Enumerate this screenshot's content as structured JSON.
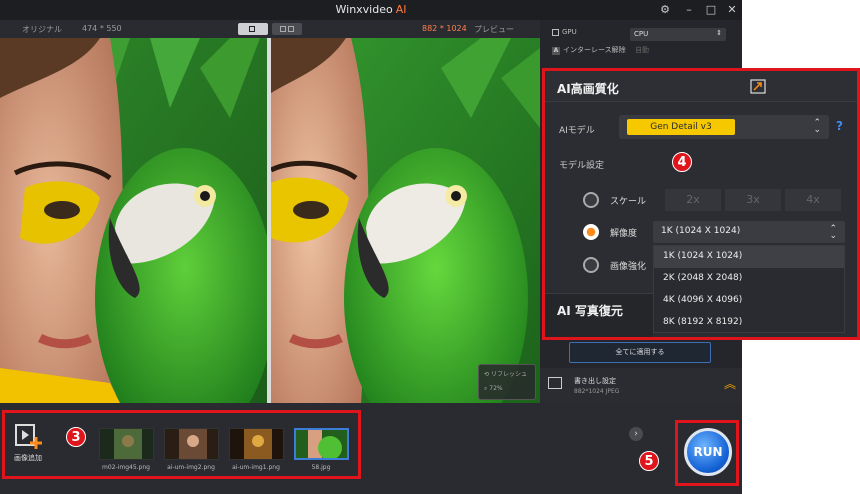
{
  "window": {
    "title": "Winxvideo",
    "title_ai": "AI"
  },
  "preview": {
    "original_label": "オリジナル",
    "original_res": "474 * 550",
    "preview_label": "プレビュー",
    "preview_res": "882 * 1024",
    "refresh_label": "リフレッシュ",
    "zoom": "72%"
  },
  "side": {
    "gpu_label": "GPU",
    "cpu_value": "CPU",
    "deinterlace_label": "インターレース解除",
    "deinterlace_value": "自動",
    "apply_all": "全てに適用する",
    "export_title": "書き出し設定",
    "export_info": "882*1024  JPEG"
  },
  "ai_panel": {
    "title": "AI高画質化",
    "model_label": "AIモデル",
    "model_value": "Gen Detail v3",
    "help": "?",
    "settings_label": "モデル設定",
    "scale_label": "スケール",
    "scale_options": [
      "2x",
      "3x",
      "4x"
    ],
    "resolution_label": "解像度",
    "resolution_value": "1K (1024 X 1024)",
    "enhance_label": "画像強化",
    "resolution_options": [
      "1K (1024 X 1024)",
      "2K (2048 X 2048)",
      "4K (4096 X 4096)",
      "8K (8192 X 8192)"
    ],
    "photo_restore": "AI 写真復元"
  },
  "bottom": {
    "add_image": "画像追加",
    "files": [
      "m02-img45.png",
      "ai-um-img2.png",
      "ai-um-img1.png",
      "58.jpg"
    ],
    "run": "RUN"
  },
  "annotations": {
    "badge3": "3",
    "badge4": "4",
    "badge5": "5"
  },
  "colors": {
    "accent_orange": "#ff7a3c",
    "run_blue": "#1563d6",
    "highlight_red": "#e0141b",
    "model_yellow": "#f5c800"
  }
}
